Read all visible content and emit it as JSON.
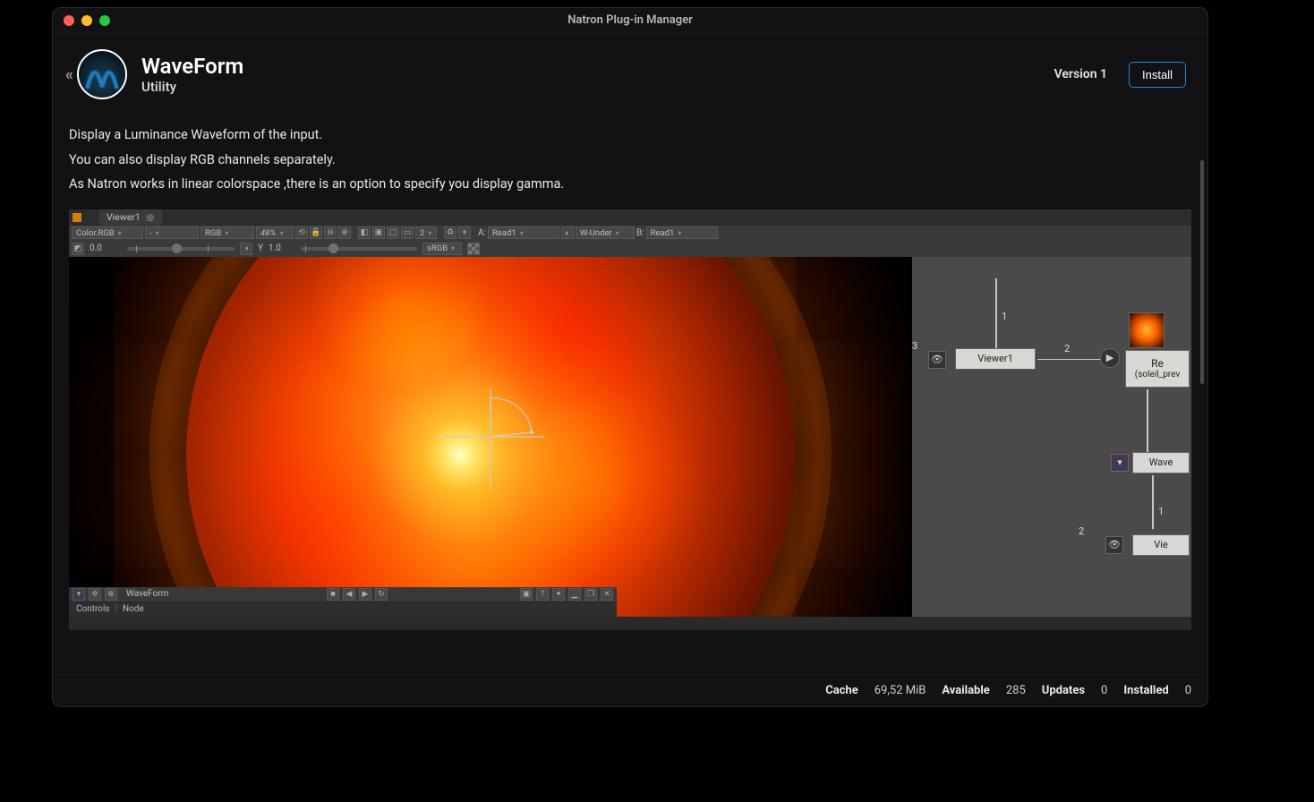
{
  "window": {
    "title": "Natron Plug-in Manager"
  },
  "header": {
    "plugin_name": "WaveForm",
    "plugin_category": "Utility",
    "version_label": "Version 1",
    "install_label": "Install"
  },
  "description": {
    "line1": "Display a Luminance Waveform of the input.",
    "line2": "You can also display RGB channels separately.",
    "line3": "As Natron works in linear colorspace ,there is an option to specify you display gamma."
  },
  "screenshot": {
    "tab_name": "Viewer1",
    "tb": {
      "layer": "Color.RGB",
      "alpha": "-",
      "channels": "RGB",
      "zoom": "48%",
      "twobox": "2",
      "a_label": "A:",
      "a_val": "Read1",
      "wipe": "W-Under",
      "b_label": "B:",
      "b_val": "Read1"
    },
    "slider": {
      "gamma_val": "0.0",
      "y_label": "Y",
      "y_val": "1.0",
      "colorspace": "sRGB"
    },
    "propbar": {
      "node": "WaveForm",
      "tab1": "Controls",
      "tab2": "Node"
    },
    "graph": {
      "viewer1": "Viewer1",
      "read1": "Re",
      "read1_sub": "(soleil_prev",
      "waveform": "Wave",
      "viewer2": "Vie",
      "n1": "1",
      "n2": "2",
      "n3": "3"
    }
  },
  "footer": {
    "cache_label": "Cache",
    "cache_val": "69,52 MiB",
    "available_label": "Available",
    "available_val": "285",
    "updates_label": "Updates",
    "updates_val": "0",
    "installed_label": "Installed",
    "installed_val": "0"
  }
}
